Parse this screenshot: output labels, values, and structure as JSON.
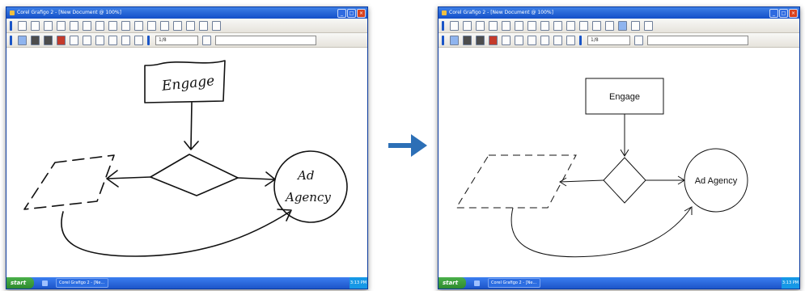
{
  "app": {
    "title": "Corel Grafigo 2 - [New Document @ 100%]",
    "start_label": "start",
    "taskbar_item": "Corel Grafigo 2 - [Ne...",
    "clock": "3:13 PM",
    "pen_width_field": "1/8",
    "window_buttons": [
      "_",
      "□",
      "×"
    ]
  },
  "left_canvas": {
    "engage_text": "Engage",
    "ad_text_line1": "Ad",
    "ad_text_line2": "Agency"
  },
  "right_canvas": {
    "engage_text": "Engage",
    "ad_text": "Ad Agency"
  },
  "colors": {
    "titlebar": "#1450c8",
    "arrow": "#2c6fb6",
    "taskbar": "#1d55c9",
    "start": "#2e8a2e"
  },
  "icons": {
    "transform_arrow": "right-arrow-icon"
  }
}
